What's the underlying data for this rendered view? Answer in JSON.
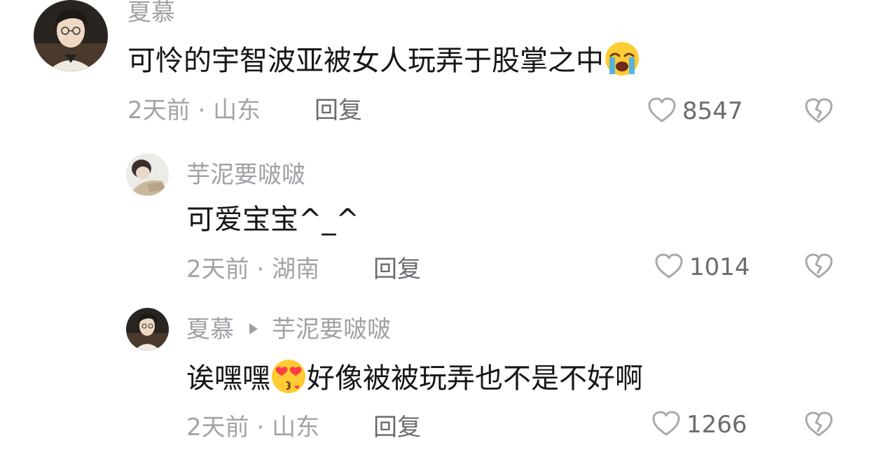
{
  "comments": [
    {
      "username": "夏慕",
      "text": "可怜的宇智波亚被女人玩弄于股掌之中",
      "emoji": "loudly-crying-face",
      "time": "2天前",
      "location": "山东",
      "reply_label": "回复",
      "likes": "8547"
    },
    {
      "username": "芋泥要啵啵",
      "text": "可爱宝宝^_^",
      "time": "2天前",
      "location": "湖南",
      "reply_label": "回复",
      "likes": "1014"
    },
    {
      "username": "夏慕",
      "reply_to": "芋泥要啵啵",
      "text_before": "诶嘿嘿",
      "emoji": "kissing-heart-eyes-face",
      "text_after": "好像被被玩弄也不是不好啊",
      "time": "2天前",
      "location": "山东",
      "reply_label": "回复",
      "likes": "1266"
    }
  ],
  "meta_separator": " · ",
  "icons": {
    "like": "heart-outline-icon",
    "dislike": "broken-heart-icon"
  },
  "colors": {
    "text": "#161616",
    "muted": "#a0a0a6",
    "action": "#6b6b70"
  }
}
